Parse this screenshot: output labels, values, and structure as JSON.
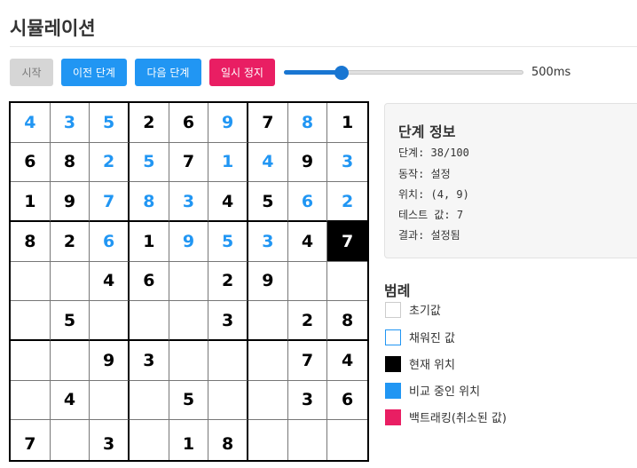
{
  "page": {
    "title": "시뮬레이션"
  },
  "controls": {
    "start_label": "시작",
    "prev_label": "이전 단계",
    "next_label": "다음 단계",
    "pause_label": "일시 정지",
    "speed_fraction": 0.24,
    "speed_label": "500ms"
  },
  "board": {
    "rows": [
      [
        {
          "v": "4",
          "s": "filled"
        },
        {
          "v": "3",
          "s": "filled"
        },
        {
          "v": "5",
          "s": "filled"
        },
        {
          "v": "2",
          "s": "initial"
        },
        {
          "v": "6",
          "s": "initial"
        },
        {
          "v": "9",
          "s": "filled"
        },
        {
          "v": "7",
          "s": "initial"
        },
        {
          "v": "8",
          "s": "filled"
        },
        {
          "v": "1",
          "s": "initial"
        }
      ],
      [
        {
          "v": "6",
          "s": "initial"
        },
        {
          "v": "8",
          "s": "initial"
        },
        {
          "v": "2",
          "s": "filled"
        },
        {
          "v": "5",
          "s": "filled"
        },
        {
          "v": "7",
          "s": "initial"
        },
        {
          "v": "1",
          "s": "filled"
        },
        {
          "v": "4",
          "s": "filled"
        },
        {
          "v": "9",
          "s": "initial"
        },
        {
          "v": "3",
          "s": "filled"
        }
      ],
      [
        {
          "v": "1",
          "s": "initial"
        },
        {
          "v": "9",
          "s": "initial"
        },
        {
          "v": "7",
          "s": "filled"
        },
        {
          "v": "8",
          "s": "filled"
        },
        {
          "v": "3",
          "s": "filled"
        },
        {
          "v": "4",
          "s": "initial"
        },
        {
          "v": "5",
          "s": "initial"
        },
        {
          "v": "6",
          "s": "filled"
        },
        {
          "v": "2",
          "s": "filled"
        }
      ],
      [
        {
          "v": "8",
          "s": "initial"
        },
        {
          "v": "2",
          "s": "initial"
        },
        {
          "v": "6",
          "s": "filled"
        },
        {
          "v": "1",
          "s": "initial"
        },
        {
          "v": "9",
          "s": "filled"
        },
        {
          "v": "5",
          "s": "filled"
        },
        {
          "v": "3",
          "s": "filled"
        },
        {
          "v": "4",
          "s": "initial"
        },
        {
          "v": "7",
          "s": "current"
        }
      ],
      [
        {
          "v": "",
          "s": "empty"
        },
        {
          "v": "",
          "s": "empty"
        },
        {
          "v": "4",
          "s": "initial"
        },
        {
          "v": "6",
          "s": "initial"
        },
        {
          "v": "",
          "s": "empty"
        },
        {
          "v": "2",
          "s": "initial"
        },
        {
          "v": "9",
          "s": "initial"
        },
        {
          "v": "",
          "s": "empty"
        },
        {
          "v": "",
          "s": "empty"
        }
      ],
      [
        {
          "v": "",
          "s": "empty"
        },
        {
          "v": "5",
          "s": "initial"
        },
        {
          "v": "",
          "s": "empty"
        },
        {
          "v": "",
          "s": "empty"
        },
        {
          "v": "",
          "s": "empty"
        },
        {
          "v": "3",
          "s": "initial"
        },
        {
          "v": "",
          "s": "empty"
        },
        {
          "v": "2",
          "s": "initial"
        },
        {
          "v": "8",
          "s": "initial"
        }
      ],
      [
        {
          "v": "",
          "s": "empty"
        },
        {
          "v": "",
          "s": "empty"
        },
        {
          "v": "9",
          "s": "initial"
        },
        {
          "v": "3",
          "s": "initial"
        },
        {
          "v": "",
          "s": "empty"
        },
        {
          "v": "",
          "s": "empty"
        },
        {
          "v": "",
          "s": "empty"
        },
        {
          "v": "7",
          "s": "initial"
        },
        {
          "v": "4",
          "s": "initial"
        }
      ],
      [
        {
          "v": "",
          "s": "empty"
        },
        {
          "v": "4",
          "s": "initial"
        },
        {
          "v": "",
          "s": "empty"
        },
        {
          "v": "",
          "s": "empty"
        },
        {
          "v": "5",
          "s": "initial"
        },
        {
          "v": "",
          "s": "empty"
        },
        {
          "v": "",
          "s": "empty"
        },
        {
          "v": "3",
          "s": "initial"
        },
        {
          "v": "6",
          "s": "initial"
        }
      ],
      [
        {
          "v": "7",
          "s": "initial"
        },
        {
          "v": "",
          "s": "empty"
        },
        {
          "v": "3",
          "s": "initial"
        },
        {
          "v": "",
          "s": "empty"
        },
        {
          "v": "1",
          "s": "initial"
        },
        {
          "v": "8",
          "s": "initial"
        },
        {
          "v": "",
          "s": "empty"
        },
        {
          "v": "",
          "s": "empty"
        },
        {
          "v": "",
          "s": "empty"
        }
      ]
    ]
  },
  "info": {
    "title": "단계 정보",
    "step": "단계: 38/100",
    "action": "동작: 설정",
    "position": "위치: (4, 9)",
    "test_value": "테스트 값: 7",
    "result": "결과: 설정됨"
  },
  "legend": {
    "title": "범례",
    "items": [
      {
        "label": "초기값",
        "kind": "initial",
        "icon": "square-outline-gray-icon"
      },
      {
        "label": "채워진 값",
        "kind": "filled",
        "icon": "square-outline-blue-icon"
      },
      {
        "label": "현재 위치",
        "kind": "current",
        "icon": "square-black-icon"
      },
      {
        "label": "비교 중인 위치",
        "kind": "compare",
        "icon": "square-blue-icon"
      },
      {
        "label": "백트래킹(취소된 값)",
        "kind": "backtrack",
        "icon": "square-pink-icon"
      }
    ]
  },
  "colors": {
    "primary": "#2196f3",
    "danger": "#e91e63",
    "disabled": "#d6d6d6",
    "current_cell": "#000000",
    "filled_text": "#2196f3"
  }
}
